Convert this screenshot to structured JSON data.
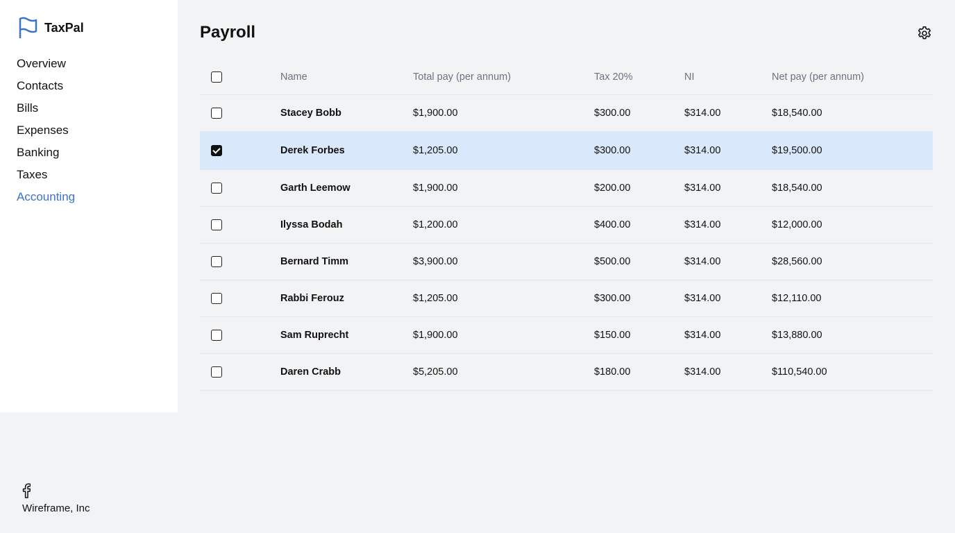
{
  "app": {
    "name": "TaxPal",
    "logo_icon": "flag-icon",
    "brand_color": "#3b73cf"
  },
  "sidebar": {
    "items": [
      {
        "label": "Overview",
        "active": false
      },
      {
        "label": "Contacts",
        "active": false
      },
      {
        "label": "Bills",
        "active": false
      },
      {
        "label": "Expenses",
        "active": false
      },
      {
        "label": "Banking",
        "active": false
      },
      {
        "label": "Taxes",
        "active": false
      },
      {
        "label": "Accounting",
        "active": true
      }
    ]
  },
  "footer": {
    "icon": "facebook-icon",
    "company": "Wireframe, Inc"
  },
  "page": {
    "title": "Payroll",
    "settings_icon": "gear-icon"
  },
  "table": {
    "columns": {
      "name": "Name",
      "total": "Total pay (per annum)",
      "tax": "Tax 20%",
      "ni": "NI",
      "net": "Net pay (per annum)"
    },
    "select_all_checked": false,
    "rows": [
      {
        "name": "Stacey Bobb",
        "total": "$1,900.00",
        "tax": "$300.00",
        "ni": "$314.00",
        "net": "$18,540.00",
        "checked": false
      },
      {
        "name": "Derek Forbes",
        "total": "$1,205.00",
        "tax": "$300.00",
        "ni": "$314.00",
        "net": "$19,500.00",
        "checked": true
      },
      {
        "name": "Garth Leemow",
        "total": "$1,900.00",
        "tax": "$200.00",
        "ni": "$314.00",
        "net": "$18,540.00",
        "checked": false
      },
      {
        "name": "Ilyssa Bodah",
        "total": "$1,200.00",
        "tax": "$400.00",
        "ni": "$314.00",
        "net": "$12,000.00",
        "checked": false
      },
      {
        "name": "Bernard Timm",
        "total": "$3,900.00",
        "tax": "$500.00",
        "ni": "$314.00",
        "net": "$28,560.00",
        "checked": false
      },
      {
        "name": "Rabbi Ferouz",
        "total": "$1,205.00",
        "tax": "$300.00",
        "ni": "$314.00",
        "net": "$12,110.00",
        "checked": false
      },
      {
        "name": "Sam Ruprecht",
        "total": "$1,900.00",
        "tax": "$150.00",
        "ni": "$314.00",
        "net": "$13,880.00",
        "checked": false
      },
      {
        "name": "Daren Crabb",
        "total": "$5,205.00",
        "tax": "$180.00",
        "ni": "$314.00",
        "net": "$110,540.00",
        "checked": false
      }
    ]
  }
}
